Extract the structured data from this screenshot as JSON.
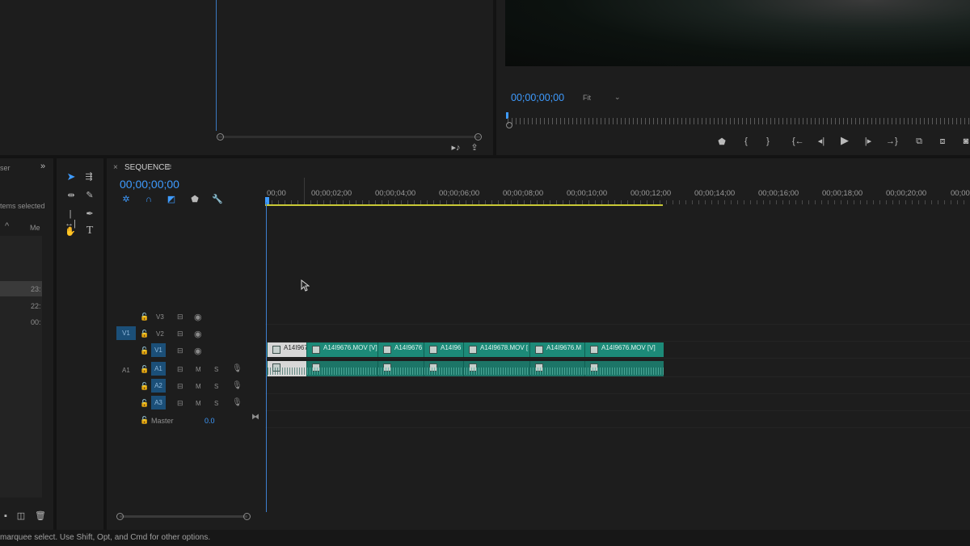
{
  "source_monitor": {
    "scroll_icon_name": "circle-handle-icon"
  },
  "program_monitor": {
    "timecode": "00;00;00;00",
    "zoom": "Fit",
    "controls": [
      "add-marker",
      "mark-in",
      "mark-out",
      "go-to-in",
      "step-back",
      "play",
      "step-forward",
      "go-to-out",
      "lift",
      "extract",
      "export-frame"
    ]
  },
  "project_panel": {
    "title_partial": "ser",
    "items_selected": "tems selected",
    "col_label": "Me",
    "rows": [
      "23:",
      "22:",
      "00:"
    ]
  },
  "tools": [
    "selection",
    "track-select-forward",
    "ripple-edit",
    "razor",
    "slip",
    "pen",
    "hand",
    "type"
  ],
  "sequence": {
    "close": "×",
    "name": "SEQUENCE",
    "menu": "≡",
    "timecode": "00;00;00;00",
    "ruler": [
      "00;00",
      "00;00;02;00",
      "00;00;04;00",
      "00;00;06;00",
      "00;00;08;00",
      "00;00;10;00",
      "00;00;12;00",
      "00;00;14;00",
      "00;00;16;00",
      "00;00;18;00",
      "00;00;20;00",
      "00;00"
    ],
    "tracks": {
      "video": [
        {
          "name": "V3"
        },
        {
          "name": "V2",
          "source": "V1"
        },
        {
          "name": "V1"
        }
      ],
      "audio": [
        {
          "name": "A1",
          "source": "A1",
          "m": "M",
          "s": "S"
        },
        {
          "name": "A2",
          "m": "M",
          "s": "S"
        },
        {
          "name": "A3",
          "m": "M",
          "s": "S"
        }
      ],
      "master_label": "Master",
      "master_value": "0.0"
    },
    "clips": [
      "A14I967",
      "A14I9676.MOV [V]",
      "A14I9676",
      "A14I96",
      "A14I9678.MOV [",
      "A14I9676.M",
      "A14I9676.MOV [V]"
    ]
  },
  "status_bar": "marquee select. Use Shift, Opt, and Cmd for other options."
}
